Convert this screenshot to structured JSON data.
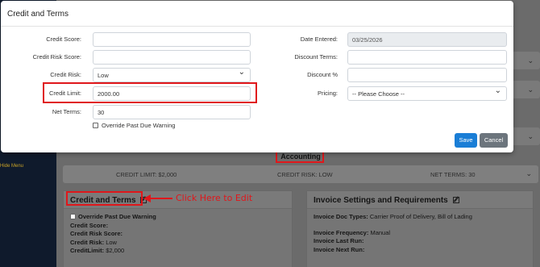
{
  "modal": {
    "title": "Credit and Terms",
    "left_fields": [
      {
        "label": "Credit Score:",
        "value": ""
      },
      {
        "label": "Credit Risk Score:",
        "value": ""
      },
      {
        "label": "Credit Risk:",
        "value": "Low"
      },
      {
        "label": "Credit Limit:",
        "value": "2000.00"
      },
      {
        "label": "Net Terms:",
        "value": "30"
      }
    ],
    "override_label": "Override Past Due Warning",
    "right_fields": [
      {
        "label": "Date Entered:",
        "value": "03/25/2026"
      },
      {
        "label": "Discount Terms:",
        "value": ""
      },
      {
        "label": "Discount %",
        "value": ""
      },
      {
        "label": "Pricing:",
        "value": "-- Please Choose --"
      }
    ],
    "save_label": "Save",
    "cancel_label": "Cancel"
  },
  "background": {
    "sidebar_hide_menu": "Hide Menu",
    "section_title": "Accounting",
    "stats": {
      "credit_limit": "CREDIT LIMIT: $2,000",
      "credit_risk": "CREDIT RISK: LOW",
      "net_terms": "NET TERMS: 30"
    },
    "credit_panel": {
      "title": "Credit and Terms",
      "override_label": "Override Past Due Warning",
      "credit_score_label": "Credit Score:",
      "credit_risk_score_label": "Credit Risk Score:",
      "credit_risk_label": "Credit Risk:",
      "credit_risk_value": "Low",
      "credit_limit_label": "CreditLimit:",
      "credit_limit_value": "$2,000"
    },
    "invoice_panel": {
      "title": "Invoice Settings and Requirements",
      "doc_types_label": "Invoice Doc Types:",
      "doc_types_value": "Carrier Proof of Delivery, Bill of Lading",
      "frequency_label": "Invoice Frequency:",
      "frequency_value": "Manual",
      "last_run_label": "Invoice Last Run:",
      "next_run_label": "Invoice Next Run:"
    }
  },
  "annotation": {
    "callout_text": "Click Here to Edit",
    "color": "#e0171b"
  }
}
